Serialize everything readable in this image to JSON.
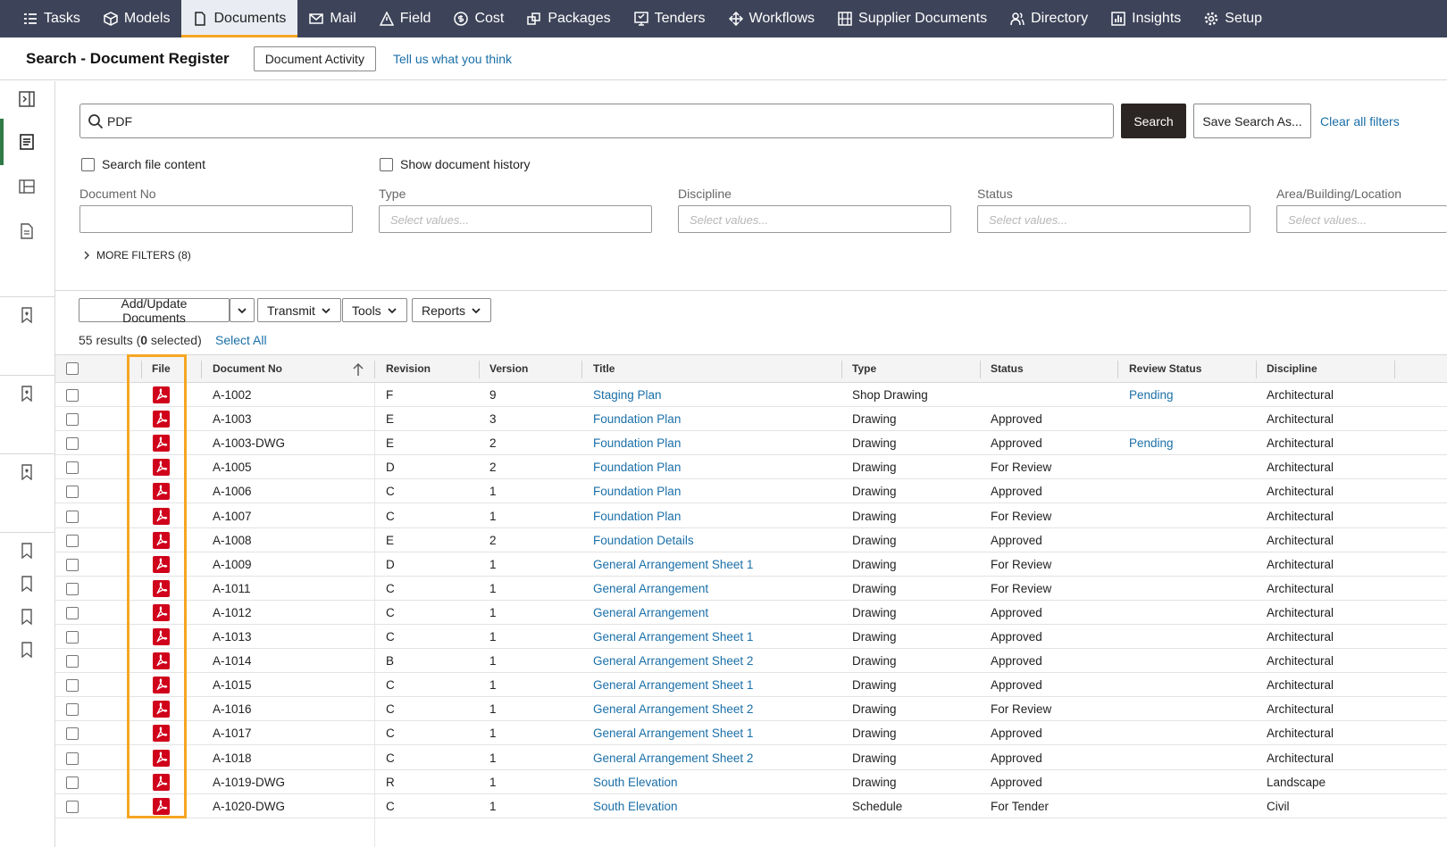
{
  "nav": {
    "items": [
      {
        "label": "Tasks",
        "icon": "tasks-icon"
      },
      {
        "label": "Models",
        "icon": "cube-icon"
      },
      {
        "label": "Documents",
        "icon": "document-icon",
        "active": true
      },
      {
        "label": "Mail",
        "icon": "mail-icon"
      },
      {
        "label": "Field",
        "icon": "warning-triangle-icon"
      },
      {
        "label": "Cost",
        "icon": "dollar-icon"
      },
      {
        "label": "Packages",
        "icon": "packages-icon"
      },
      {
        "label": "Tenders",
        "icon": "tenders-icon"
      },
      {
        "label": "Workflows",
        "icon": "workflows-icon"
      },
      {
        "label": "Supplier Documents",
        "icon": "building-icon"
      },
      {
        "label": "Directory",
        "icon": "people-icon"
      },
      {
        "label": "Insights",
        "icon": "bar-chart-icon"
      },
      {
        "label": "Setup",
        "icon": "gear-icon"
      }
    ]
  },
  "header": {
    "title": "Search - Document Register",
    "activity_button": "Document Activity",
    "feedback_link": "Tell us what you think"
  },
  "search": {
    "value": "PDF",
    "search_button": "Search",
    "save_button": "Save Search As...",
    "clear_link": "Clear all filters",
    "search_file_content": "Search file content",
    "show_history": "Show document history"
  },
  "filters": {
    "document_no_label": "Document No",
    "type_label": "Type",
    "discipline_label": "Discipline",
    "status_label": "Status",
    "area_label": "Area/Building/Location",
    "placeholder": "Select values...",
    "more_filters": "MORE FILTERS (8)"
  },
  "toolbar": {
    "add_update": "Add/Update Documents",
    "transmit": "Transmit",
    "tools": "Tools",
    "reports": "Reports"
  },
  "results": {
    "count_prefix": "55 results (",
    "selected_count": "0",
    "count_suffix": " selected)",
    "select_all": "Select All"
  },
  "table": {
    "columns": {
      "file": "File",
      "document_no": "Document No",
      "revision": "Revision",
      "version": "Version",
      "title": "Title",
      "type": "Type",
      "status": "Status",
      "review_status": "Review Status",
      "discipline": "Discipline"
    },
    "rows": [
      {
        "doc": "A-1002",
        "rev": "F",
        "ver": "9",
        "title": "Staging Plan",
        "type": "Shop Drawing",
        "status": "",
        "review": "Pending",
        "disc": "Architectural"
      },
      {
        "doc": "A-1003",
        "rev": "E",
        "ver": "3",
        "title": "Foundation Plan",
        "type": "Drawing",
        "status": "Approved",
        "review": "",
        "disc": "Architectural"
      },
      {
        "doc": "A-1003-DWG",
        "rev": "E",
        "ver": "2",
        "title": "Foundation Plan",
        "type": "Drawing",
        "status": "Approved",
        "review": "Pending",
        "disc": "Architectural"
      },
      {
        "doc": "A-1005",
        "rev": "D",
        "ver": "2",
        "title": "Foundation Plan",
        "type": "Drawing",
        "status": "For Review",
        "review": "",
        "disc": "Architectural"
      },
      {
        "doc": "A-1006",
        "rev": "C",
        "ver": "1",
        "title": "Foundation Plan",
        "type": "Drawing",
        "status": "Approved",
        "review": "",
        "disc": "Architectural"
      },
      {
        "doc": "A-1007",
        "rev": "C",
        "ver": "1",
        "title": "Foundation Plan",
        "type": "Drawing",
        "status": "For Review",
        "review": "",
        "disc": "Architectural"
      },
      {
        "doc": "A-1008",
        "rev": "E",
        "ver": "2",
        "title": "Foundation Details",
        "type": "Drawing",
        "status": "Approved",
        "review": "",
        "disc": "Architectural"
      },
      {
        "doc": "A-1009",
        "rev": "D",
        "ver": "1",
        "title": "General Arrangement Sheet 1",
        "type": "Drawing",
        "status": "For Review",
        "review": "",
        "disc": "Architectural"
      },
      {
        "doc": "A-1011",
        "rev": "C",
        "ver": "1",
        "title": "General Arrangement",
        "type": "Drawing",
        "status": "For Review",
        "review": "",
        "disc": "Architectural"
      },
      {
        "doc": "A-1012",
        "rev": "C",
        "ver": "1",
        "title": "General Arrangement",
        "type": "Drawing",
        "status": "Approved",
        "review": "",
        "disc": "Architectural"
      },
      {
        "doc": "A-1013",
        "rev": "C",
        "ver": "1",
        "title": "General Arrangement Sheet 1",
        "type": "Drawing",
        "status": "Approved",
        "review": "",
        "disc": "Architectural"
      },
      {
        "doc": "A-1014",
        "rev": "B",
        "ver": "1",
        "title": "General Arrangement Sheet 2",
        "type": "Drawing",
        "status": "Approved",
        "review": "",
        "disc": "Architectural"
      },
      {
        "doc": "A-1015",
        "rev": "C",
        "ver": "1",
        "title": "General Arrangement Sheet 1",
        "type": "Drawing",
        "status": "Approved",
        "review": "",
        "disc": "Architectural"
      },
      {
        "doc": "A-1016",
        "rev": "C",
        "ver": "1",
        "title": "General Arrangement Sheet 2",
        "type": "Drawing",
        "status": "For Review",
        "review": "",
        "disc": "Architectural"
      },
      {
        "doc": "A-1017",
        "rev": "C",
        "ver": "1",
        "title": "General Arrangement Sheet 1",
        "type": "Drawing",
        "status": "Approved",
        "review": "",
        "disc": "Architectural"
      },
      {
        "doc": "A-1018",
        "rev": "C",
        "ver": "1",
        "title": "General Arrangement Sheet 2",
        "type": "Drawing",
        "status": "Approved",
        "review": "",
        "disc": "Architectural"
      },
      {
        "doc": "A-1019-DWG",
        "rev": "R",
        "ver": "1",
        "title": "South Elevation",
        "type": "Drawing",
        "status": "Approved",
        "review": "",
        "disc": "Landscape"
      },
      {
        "doc": "A-1020-DWG",
        "rev": "C",
        "ver": "1",
        "title": "South Elevation",
        "type": "Schedule",
        "status": "For Tender",
        "review": "",
        "disc": "Civil"
      }
    ]
  },
  "colors": {
    "nav_bg": "#3d4459",
    "accent": "#f5a623",
    "link": "#1a6fa8",
    "pdf_red": "#d0021b",
    "sidebar_active": "#2f7a46"
  }
}
